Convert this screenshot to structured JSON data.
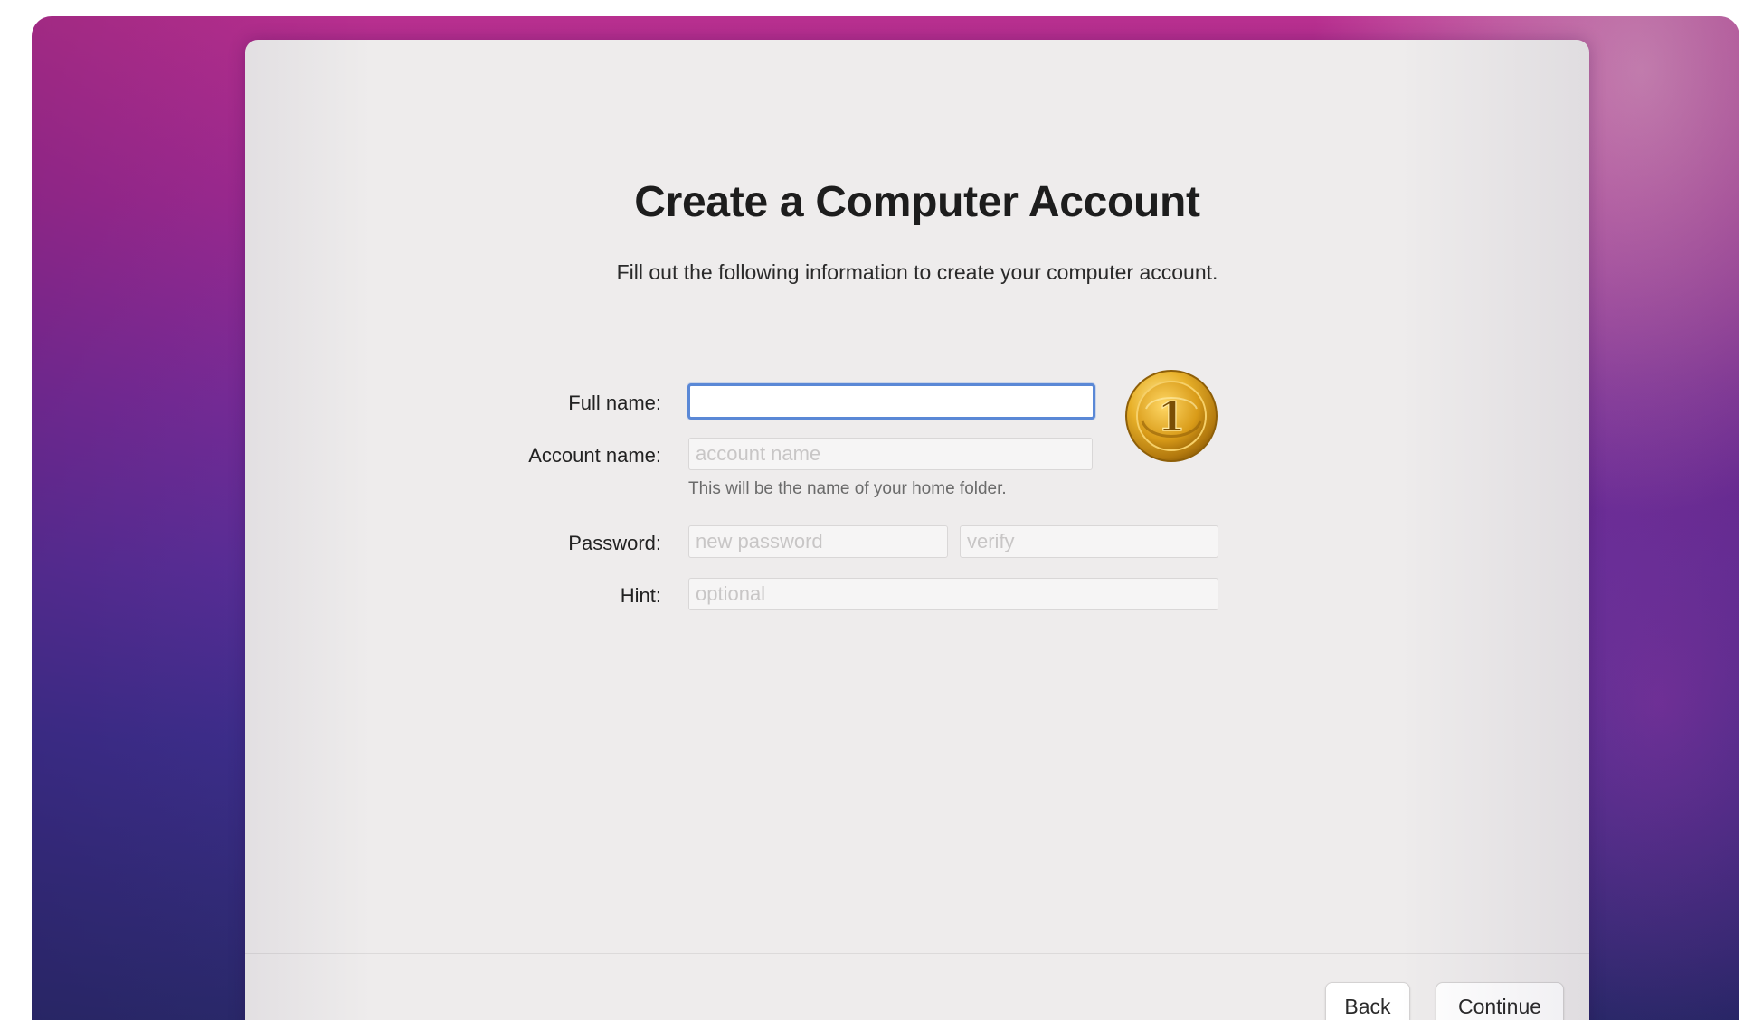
{
  "setup": {
    "title": "Create a Computer Account",
    "subtitle": "Fill out the following information to create your computer account."
  },
  "form": {
    "full_name_label": "Full name:",
    "full_name_value": "",
    "account_name_label": "Account name:",
    "account_name_placeholder": "account name",
    "account_name_help": "This will be the name of your home folder.",
    "password_label": "Password:",
    "password_placeholder": "new password",
    "verify_placeholder": "verify",
    "hint_label": "Hint:",
    "hint_placeholder": "optional"
  },
  "avatar": {
    "icon": "gold-coin-icon",
    "glyph": "1"
  },
  "footer": {
    "back_label": "Back",
    "continue_label": "Continue"
  },
  "colors": {
    "focus_ring": "#5a88d6",
    "panel": "#eeecec",
    "wallpaper_top": "#b82f8f",
    "wallpaper_bottom": "#2a2a6c",
    "coin_gold": "#e2a81f"
  }
}
